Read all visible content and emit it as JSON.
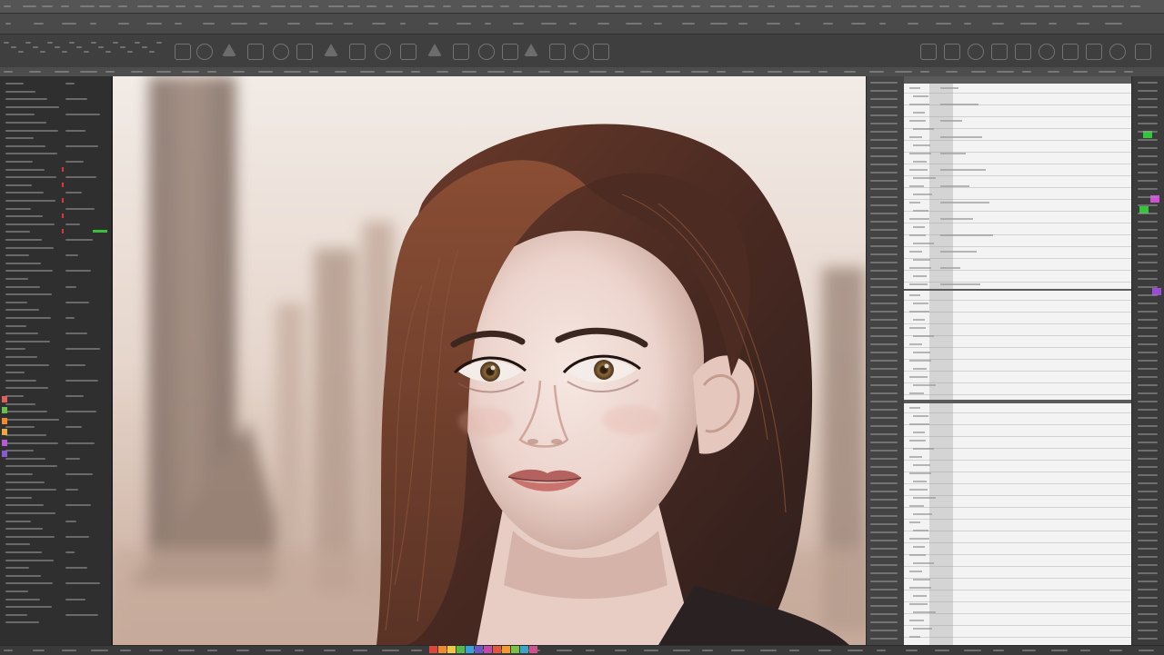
{
  "menubar": {
    "left_text": "",
    "right_text": ""
  },
  "options": {
    "workspace_label": ""
  },
  "left_panel": {
    "accent_green": "#3bbf3b",
    "accent_red": "#d43a3a",
    "swatches": [
      "#e06060",
      "#66c04a",
      "#f08a2c",
      "#f0a640",
      "#b45bd6",
      "#8a5ad0"
    ]
  },
  "right_panel": {
    "chip_green": "#33c63a",
    "chip_magenta": "#d14fd6",
    "chip_purple": "#9c4bd8"
  },
  "canvas": {
    "image_subject": "portrait-of-woman-with-brown-hair"
  },
  "statusbar": {
    "palette": [
      "#e0453a",
      "#f08a2c",
      "#f5c542",
      "#58b848",
      "#3aa0d8",
      "#6a58c8",
      "#c54aa8",
      "#e2573b",
      "#f39a2d",
      "#7bc243",
      "#35a7c7",
      "#d04f8d"
    ]
  }
}
